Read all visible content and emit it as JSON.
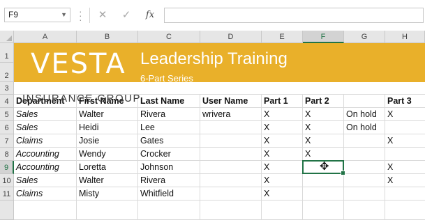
{
  "formula_bar": {
    "name_box": "F9",
    "cancel_icon": "✕",
    "enter_icon": "✓",
    "fx_label": "fx",
    "formula_value": ""
  },
  "columns": [
    "A",
    "B",
    "C",
    "D",
    "E",
    "F",
    "G",
    "H"
  ],
  "rows": [
    "1",
    "2",
    "3",
    "4",
    "5",
    "6",
    "7",
    "8",
    "9",
    "10",
    "11"
  ],
  "selected_cell": "F9",
  "banner": {
    "logo": "VESTA",
    "title": "Leadership Training",
    "subtitle": "6-Part Series",
    "tagline": "INSURANCE GROUP",
    "color": "#e9b02a"
  },
  "table": {
    "headers": [
      "Department",
      "First Name",
      "Last Name",
      "User Name",
      "Part 1",
      "Part 2",
      "",
      "Part 3"
    ],
    "rows": [
      [
        "Sales",
        "Walter",
        "Rivera",
        "wrivera",
        "X",
        "X",
        "On hold",
        "X"
      ],
      [
        "Sales",
        "Heidi",
        "Lee",
        "",
        "X",
        "X",
        "On hold",
        ""
      ],
      [
        "Claims",
        "Josie",
        "Gates",
        "",
        "X",
        "X",
        "",
        "X"
      ],
      [
        "Accounting",
        "Wendy",
        "Crocker",
        "",
        "X",
        "X",
        "",
        ""
      ],
      [
        "Accounting",
        "Loretta",
        "Johnson",
        "",
        "X",
        "",
        "",
        "X"
      ],
      [
        "Sales",
        "Walter",
        "Rivera",
        "",
        "X",
        "",
        "",
        "X"
      ],
      [
        "Claims",
        "Misty",
        "Whitfield",
        "",
        "X",
        "",
        "",
        ""
      ]
    ]
  }
}
